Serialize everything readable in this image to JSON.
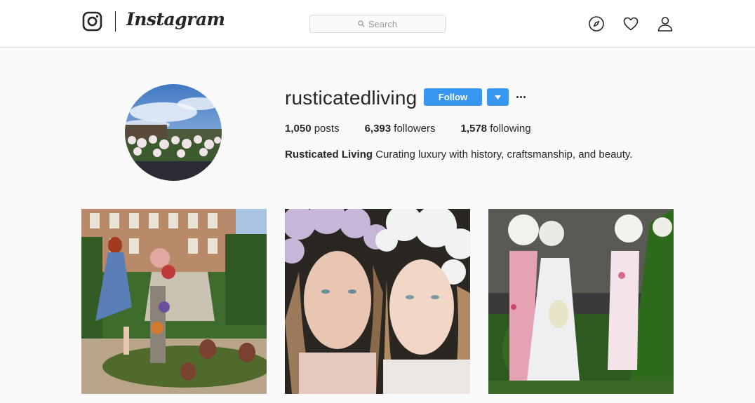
{
  "nav": {
    "logo_icon": "instagram-camera-icon",
    "wordmark": "Instagram",
    "search_placeholder": "Search",
    "icons": [
      "compass-icon",
      "heart-icon",
      "person-icon"
    ]
  },
  "profile": {
    "username": "rusticatedliving",
    "follow_label": "Follow",
    "stats": {
      "posts_count": "1,050",
      "posts_label": "posts",
      "followers_count": "6,393",
      "followers_label": "followers",
      "following_count": "1,578",
      "following_label": "following"
    },
    "bio": {
      "full_name": "Rusticated Living",
      "text": "Curating luxury with history, craftsmanship, and beauty."
    }
  },
  "colors": {
    "accent": "#3897f0",
    "background": "#fafafa",
    "text": "#262626",
    "border": "#dbdbdb"
  }
}
